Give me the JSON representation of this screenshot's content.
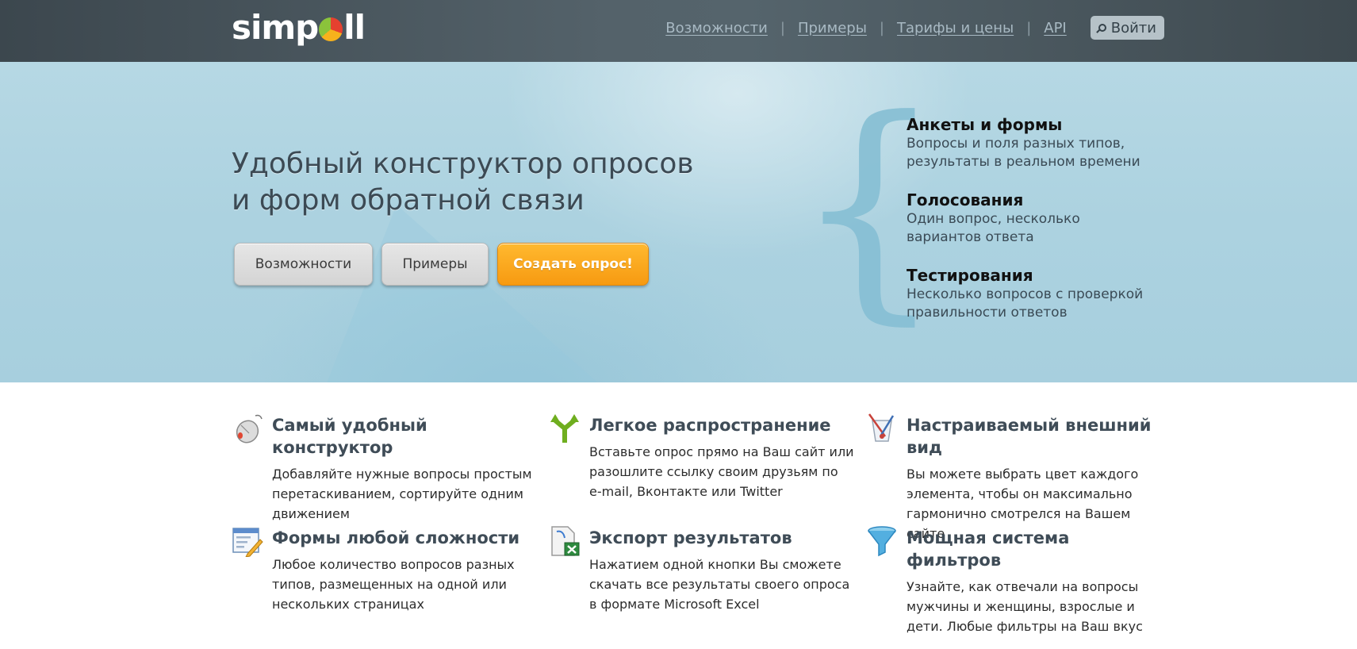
{
  "header": {
    "logo_text_left": "simp",
    "logo_text_right": "ll",
    "nav": [
      {
        "label": "Возможности"
      },
      {
        "label": "Примеры"
      },
      {
        "label": "Тарифы и цены"
      },
      {
        "label": "API"
      }
    ],
    "login_label": "Войти"
  },
  "hero": {
    "title_line1": "Удобный конструктор опросов",
    "title_line2": "и форм обратной связи",
    "buttons": {
      "features": "Возможности",
      "examples": "Примеры",
      "create": "Создать опрос!"
    },
    "brace": "{",
    "items": [
      {
        "title": "Анкеты и формы",
        "line1": "Вопросы и поля разных типов,",
        "line2": "результаты в реальном времени"
      },
      {
        "title": "Голосования",
        "line1": "Один вопрос, несколько",
        "line2": "вариантов ответа"
      },
      {
        "title": "Тестирования",
        "line1": "Несколько вопросов с проверкой",
        "line2": "правильности ответов"
      }
    ]
  },
  "features": [
    {
      "icon": "mouse-icon",
      "title": "Самый удобный конструктор",
      "lines": [
        "Добавляйте нужные вопросы простым",
        "перетаскиванием, сортируйте одним",
        "движением"
      ]
    },
    {
      "icon": "share-arrows-icon",
      "title": "Легкое распространение",
      "lines": [
        "Вставьте опрос прямо на Ваш сайт или",
        "разошлите ссылку своим друзьям по",
        "e-mail, Вконтакте или Twitter"
      ]
    },
    {
      "icon": "paint-cup-icon",
      "title": "Настраиваемый внешний вид",
      "lines": [
        "Вы можете выбрать цвет каждого",
        "элемента, чтобы он максимально",
        "гармонично смотрелся на Вашем сайте"
      ]
    },
    {
      "icon": "form-edit-icon",
      "title": "Формы любой сложности",
      "lines": [
        "Любое количество вопросов разных",
        "типов, размещенных на одной или",
        "нескольких страницах"
      ]
    },
    {
      "icon": "excel-export-icon",
      "title": "Экспорт результатов",
      "lines": [
        "Нажатием одной кнопки Вы сможете",
        "скачать все результаты своего опроса",
        "в формате Microsoft Excel"
      ]
    },
    {
      "icon": "funnel-icon",
      "title": "Мощная система фильтров",
      "lines": [
        "Узнайте, как отвечали на вопросы",
        "мужчины и женщины, взрослые и",
        "дети. Любые фильтры на Ваш вкус"
      ]
    }
  ]
}
